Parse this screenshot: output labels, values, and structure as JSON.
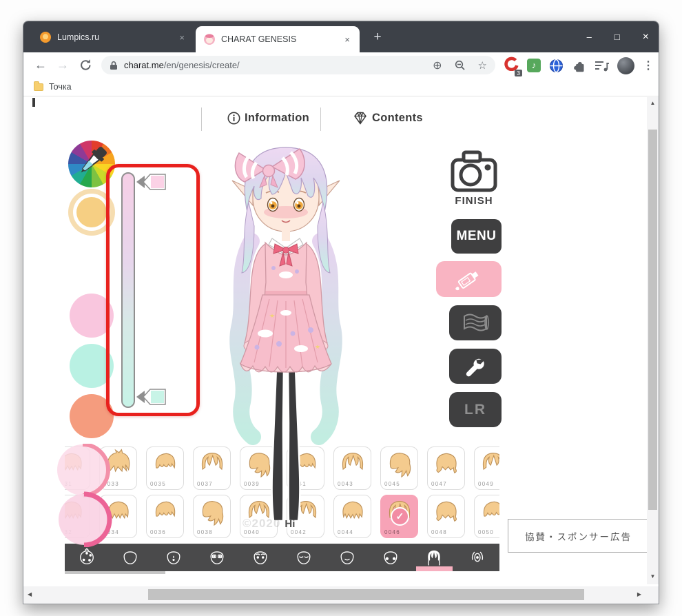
{
  "window_controls": {
    "minimize": "–",
    "maximize": "□",
    "close": "×"
  },
  "tabs": {
    "inactive": {
      "title": "Lumpics.ru"
    },
    "active": {
      "title": "CHARAT GENESIS"
    },
    "close_glyph": "×",
    "new_tab_glyph": "+"
  },
  "nav": {
    "back": "←",
    "forward": "→",
    "url_host": "charat.me",
    "url_path": "/en/genesis/create/",
    "zoom_in_glyph": "⊕",
    "star_glyph": "☆",
    "kebab_glyph": "⋮",
    "extension_badge": "3",
    "music_glyph": "♪"
  },
  "bookmarks": {
    "first_label": "Точка"
  },
  "page_header": {
    "information": "Information",
    "contents": "Contents"
  },
  "actions": {
    "finish": "FINISH",
    "menu": "MENU",
    "lr": "LR"
  },
  "sponsor": {
    "text": "協賛・スポンサー広告"
  },
  "watermark": {
    "year": "©2020",
    "name": "Hi"
  },
  "hair_grid": {
    "selected_id": "0046",
    "check_glyph": "✓",
    "row1": [
      {
        "id": "0031",
        "variant": 0
      },
      {
        "id": "0033",
        "variant": 1
      },
      {
        "id": "0035",
        "variant": 2
      },
      {
        "id": "0037",
        "variant": 3
      },
      {
        "id": "0039",
        "variant": 4
      },
      {
        "id": "0041",
        "variant": 2
      },
      {
        "id": "0043",
        "variant": 3
      },
      {
        "id": "0045",
        "variant": 4
      },
      {
        "id": "0047",
        "variant": 5
      },
      {
        "id": "0049",
        "variant": 3
      }
    ],
    "row2": [
      {
        "id": "0032",
        "variant": 0
      },
      {
        "id": "0034",
        "variant": 0
      },
      {
        "id": "0036",
        "variant": 2
      },
      {
        "id": "0038",
        "variant": 4
      },
      {
        "id": "0040",
        "variant": 3
      },
      {
        "id": "0042",
        "variant": 3
      },
      {
        "id": "0044",
        "variant": 0
      },
      {
        "id": "0046",
        "variant": 3,
        "selected": true
      },
      {
        "id": "0048",
        "variant": 5
      },
      {
        "id": "0050",
        "variant": 2
      }
    ]
  },
  "categories": [
    {
      "name": "color"
    },
    {
      "name": "contour"
    },
    {
      "name": "face"
    },
    {
      "name": "eyes"
    },
    {
      "name": "eyebrows"
    },
    {
      "name": "eyelashes"
    },
    {
      "name": "mouth"
    },
    {
      "name": "cheek"
    },
    {
      "name": "hair",
      "selected": true
    },
    {
      "name": "ear"
    }
  ],
  "scroll_glyphs": {
    "up": "▲",
    "down": "▼",
    "left": "◀",
    "right": "▶"
  },
  "colors": {
    "accent_pink": "#f7a3b7",
    "annotation_red": "#e8211d",
    "toolbar_dark": "#4a4a4b",
    "button_dark": "#3f3f40",
    "brush_button_pink": "#f9b4c2",
    "slider_top": "#f6cfe6",
    "slider_bottom": "#c7f3e7",
    "swatch_yellow": "#f6cf83",
    "swatch_pink": "#f9c6de",
    "swatch_mint": "#b9f1e3",
    "swatch_salmon": "#f59c7e"
  }
}
